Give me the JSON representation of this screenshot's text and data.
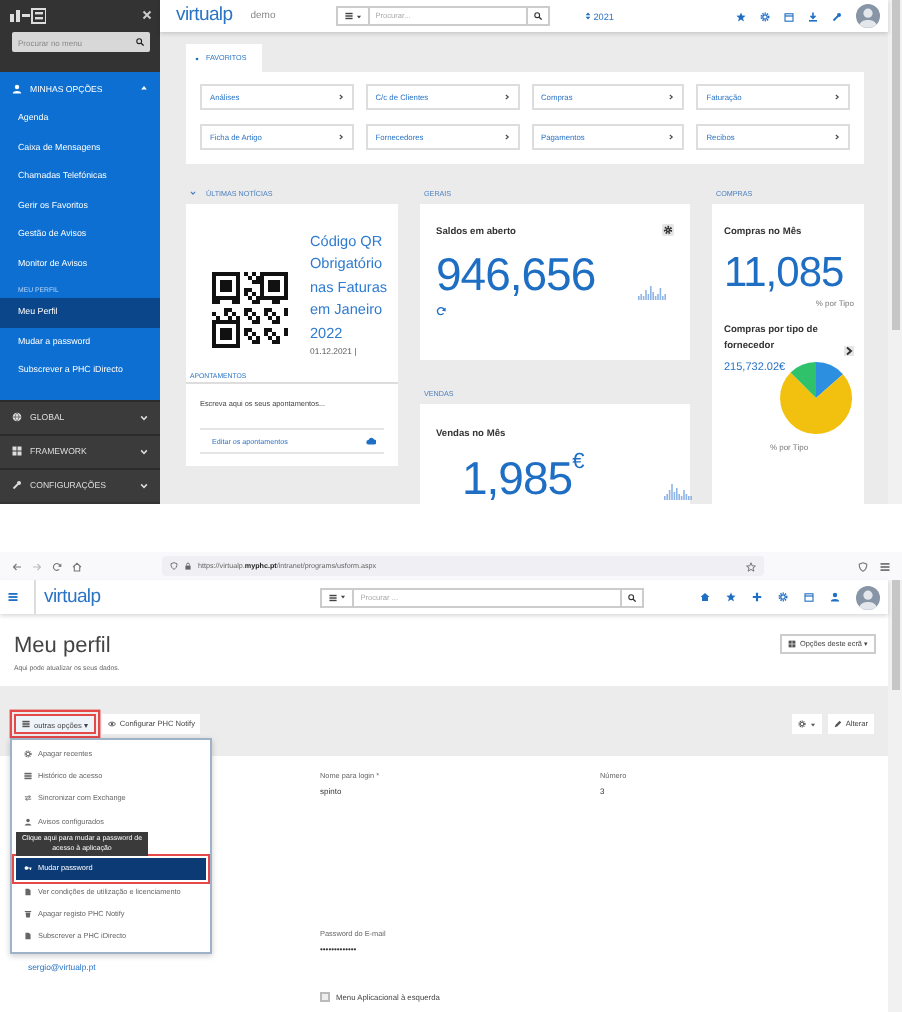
{
  "dashboard": {
    "sidebar": {
      "search": {
        "placeholder": "Procurar no menu"
      },
      "sections": [
        {
          "label": "MINHAS OPÇÕES",
          "expanded": true,
          "items": [
            {
              "kind": "link",
              "label": "Agenda",
              "selected": false
            },
            {
              "kind": "link",
              "label": "Caixa de Mensagens",
              "selected": false
            },
            {
              "kind": "link",
              "label": "Chamadas Telefónicas",
              "selected": false
            },
            {
              "kind": "link",
              "label": "Gerir os Favoritos",
              "selected": false
            },
            {
              "kind": "link",
              "label": "Gestão de Avisos",
              "selected": false
            },
            {
              "kind": "link",
              "label": "Monitor de Avisos",
              "selected": false
            },
            {
              "kind": "heading",
              "label": "MEU PERFIL"
            },
            {
              "kind": "link",
              "label": "Meu Perfil",
              "selected": true
            },
            {
              "kind": "link",
              "label": "Mudar a password",
              "selected": false
            },
            {
              "kind": "link",
              "label": "Subscrever a PHC iDirecto",
              "selected": false
            }
          ]
        },
        {
          "label": "GLOBAL",
          "expanded": false
        },
        {
          "label": "FRAMEWORK",
          "expanded": false
        },
        {
          "label": "CONFIGURAÇÕES",
          "expanded": false
        }
      ]
    },
    "header": {
      "brand": "virtualp",
      "environment": "demo",
      "search": {
        "placeholder": "Procurar..."
      },
      "year": "2021"
    },
    "favorites": {
      "tab": "FAVORITOS",
      "items": [
        "Análises",
        "C/c de Clientes",
        "Compras",
        "Faturação",
        "Ficha de Artigo",
        "Fornecedores",
        "Pagamentos",
        "Recibos"
      ]
    },
    "news": {
      "heading": "ÚLTIMAS NOTÍCIAS",
      "title": "Código QR Obrigatório nas Faturas em Janeiro 2022",
      "date": "01.12.2021 |"
    },
    "notes": {
      "heading": "APONTAMENTOS",
      "placeholder": "Escreva aqui os seus apontamentos...",
      "edit_link": "Editar os apontamentos"
    },
    "general": {
      "heading": "GERAIS",
      "card_title": "Saldos em aberto",
      "value": "946,656"
    },
    "sales": {
      "heading": "VENDAS",
      "card_title": "Vendas no Mês",
      "value": "1,985",
      "currency": "€"
    },
    "purchases": {
      "heading": "COMPRAS",
      "card_title": "Compras no Mês",
      "value": "11,085",
      "value_caption": "% por Tipo",
      "chart_title": "Compras por tipo de fornecedor",
      "chart_total": "215,732.02€",
      "chart_caption": "% por Tipo"
    }
  },
  "profile": {
    "browser": {
      "url": "https://virtualp.**myphc.pt**/intranet/programs/usform.aspx"
    },
    "header": {
      "brand": "virtualp",
      "search": {
        "placeholder": "Procurar ..."
      }
    },
    "page": {
      "title": "Meu perfil",
      "subtitle": "Aqui pode atualizar os seus dados.",
      "options_button": "Opções deste ecrã ▾"
    },
    "toolbar": {
      "buttons": [
        {
          "label": "outras opções ▾",
          "highlighted": true,
          "expanded": true
        },
        {
          "label": "Configurar PHC Notify",
          "highlighted": false,
          "expanded": false
        }
      ],
      "edit_button": "Alterar"
    },
    "menu": [
      {
        "label": "Apagar recentes",
        "selected": false,
        "highlighted": false
      },
      {
        "label": "Histórico de acesso",
        "selected": false,
        "highlighted": false
      },
      {
        "label": "Sincronizar com Exchange",
        "selected": false,
        "highlighted": false
      },
      {
        "label": "Avisos configurados",
        "selected": false,
        "highlighted": false
      },
      {
        "label": "Mudar password",
        "selected": true,
        "highlighted": true
      },
      {
        "label": "Ver condições de utilização e licenciamento",
        "selected": false,
        "highlighted": false
      },
      {
        "label": "Apagar registo PHC Notify",
        "selected": false,
        "highlighted": false
      },
      {
        "label": "Subscrever a PHC iDirecto",
        "selected": false,
        "highlighted": false
      }
    ],
    "tooltip": "Clique aqui para mudar a password de acesso à aplicação",
    "form": {
      "login": {
        "label": "Nome para login *",
        "value": "spinto"
      },
      "number": {
        "label": "Número",
        "value": "3"
      },
      "email": "sergio@virtualp.pt",
      "email_password": {
        "label": "Password do E-mail",
        "value": "•••••••••••••"
      },
      "left_menu": {
        "label": "Menu Aplicacional à esquerda",
        "checked": false
      }
    }
  }
}
